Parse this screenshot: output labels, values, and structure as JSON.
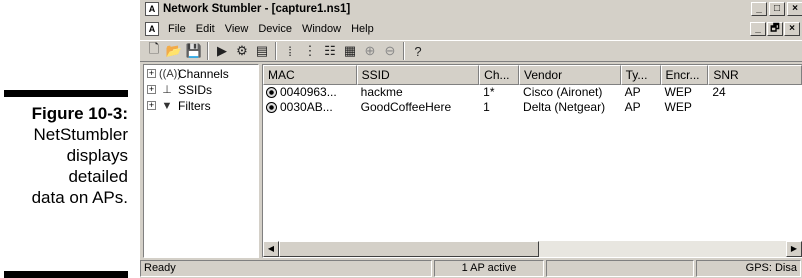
{
  "caption": {
    "figure": "Figure 10-3:",
    "lines": [
      "NetStumbler",
      "displays",
      "detailed",
      "data on APs."
    ]
  },
  "window": {
    "title": "Network Stumbler - [capture1.ns1]",
    "controls": {
      "minimize": "_",
      "restore": "□",
      "close": "×",
      "doc_restore": "🗗"
    }
  },
  "menu": {
    "items": [
      "File",
      "Edit",
      "View",
      "Device",
      "Window",
      "Help"
    ]
  },
  "toolbar": {
    "icons": [
      "new-icon",
      "open-icon",
      "save-icon",
      "play-icon",
      "scan-icon",
      "properties-icon",
      "small-icons-icon",
      "tree-icon",
      "list-icon",
      "details-icon",
      "zoom-in-icon",
      "zoom-out-icon",
      "help-icon"
    ]
  },
  "tree": {
    "items": [
      {
        "label": "Channels",
        "icon": "antenna-icon",
        "glyph": "((A))"
      },
      {
        "label": "SSIDs",
        "icon": "network-icon",
        "glyph": "⊥"
      },
      {
        "label": "Filters",
        "icon": "filter-icon",
        "glyph": "▼"
      }
    ]
  },
  "list": {
    "columns": [
      "MAC",
      "SSID",
      "Ch...",
      "Vendor",
      "Ty...",
      "Encr...",
      "SNR"
    ],
    "rows": [
      {
        "mac": "0040963...",
        "ssid": "hackme",
        "ch": "1*",
        "vendor": "Cisco (Aironet)",
        "type": "AP",
        "encr": "WEP",
        "snr": "24"
      },
      {
        "mac": "0030AB...",
        "ssid": "GoodCoffeeHere",
        "ch": "1",
        "vendor": "Delta (Netgear)",
        "type": "AP",
        "encr": "WEP",
        "snr": ""
      }
    ]
  },
  "status": {
    "ready": "Ready",
    "active": "1 AP active",
    "gps": "GPS: Disa"
  },
  "colors": {
    "face": "#d4d0c8",
    "window": "#ffffff"
  }
}
